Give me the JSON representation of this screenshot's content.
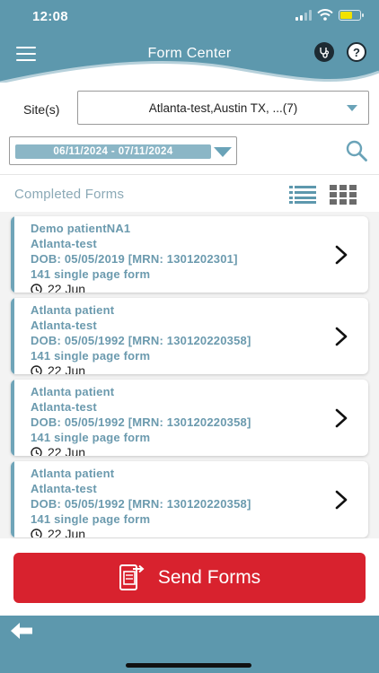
{
  "status_bar": {
    "time": "12:08"
  },
  "header": {
    "title": "Form Center"
  },
  "filters": {
    "site_label": "Site(s)",
    "site_value": "Atlanta-test,Austin TX, ...(7)",
    "date_range": "06/11/2024 - 07/11/2024"
  },
  "forms_section": {
    "title": "Completed Forms"
  },
  "forms": [
    {
      "patient": "Demo patientNA1",
      "site": "Atlanta-test",
      "dob": "DOB: 05/05/2019 [MRN: 1301202301]",
      "form": "141 single page form",
      "date": "22 Jun"
    },
    {
      "patient": "Atlanta patient",
      "site": "Atlanta-test",
      "dob": "DOB: 05/05/1992 [MRN: 130120220358]",
      "form": "141 single page form",
      "date": "22 Jun"
    },
    {
      "patient": "Atlanta patient",
      "site": "Atlanta-test",
      "dob": "DOB: 05/05/1992 [MRN: 130120220358]",
      "form": "141 single page form",
      "date": "22 Jun"
    },
    {
      "patient": "Atlanta patient",
      "site": "Atlanta-test",
      "dob": "DOB: 05/05/1992 [MRN: 130120220358]",
      "form": "141 single page form",
      "date": "22 Jun"
    }
  ],
  "send_button": {
    "label": "Send Forms"
  },
  "colors": {
    "header": "#5d98ad",
    "accent": "#6fa4b8",
    "send": "#d8222e"
  },
  "icons": [
    "menu-icon",
    "stethoscope-icon",
    "help-icon",
    "dropdown-arrow-icon",
    "search-icon",
    "list-view-icon",
    "grid-view-icon",
    "clock-icon",
    "chevron-right-icon",
    "send-forms-icon",
    "back-arrow-icon"
  ]
}
